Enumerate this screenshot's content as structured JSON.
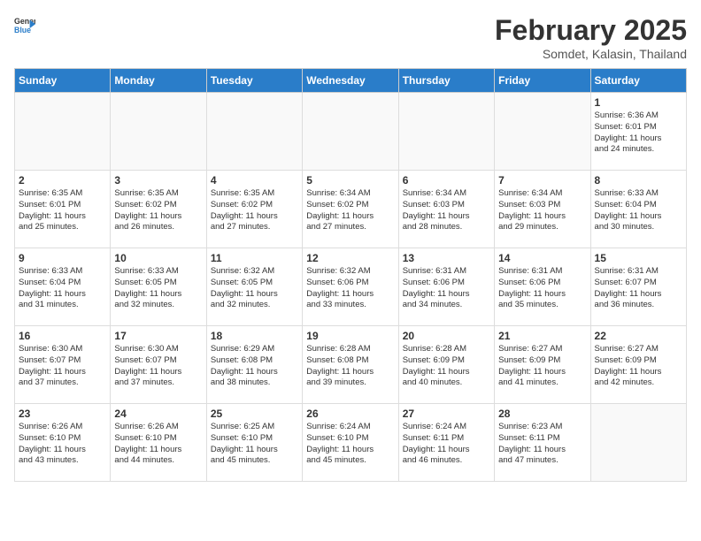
{
  "logo": {
    "general": "General",
    "blue": "Blue"
  },
  "title": "February 2025",
  "subtitle": "Somdet, Kalasin, Thailand",
  "weekdays": [
    "Sunday",
    "Monday",
    "Tuesday",
    "Wednesday",
    "Thursday",
    "Friday",
    "Saturday"
  ],
  "weeks": [
    [
      {
        "day": "",
        "info": ""
      },
      {
        "day": "",
        "info": ""
      },
      {
        "day": "",
        "info": ""
      },
      {
        "day": "",
        "info": ""
      },
      {
        "day": "",
        "info": ""
      },
      {
        "day": "",
        "info": ""
      },
      {
        "day": "1",
        "info": "Sunrise: 6:36 AM\nSunset: 6:01 PM\nDaylight: 11 hours\nand 24 minutes."
      }
    ],
    [
      {
        "day": "2",
        "info": "Sunrise: 6:35 AM\nSunset: 6:01 PM\nDaylight: 11 hours\nand 25 minutes."
      },
      {
        "day": "3",
        "info": "Sunrise: 6:35 AM\nSunset: 6:02 PM\nDaylight: 11 hours\nand 26 minutes."
      },
      {
        "day": "4",
        "info": "Sunrise: 6:35 AM\nSunset: 6:02 PM\nDaylight: 11 hours\nand 27 minutes."
      },
      {
        "day": "5",
        "info": "Sunrise: 6:34 AM\nSunset: 6:02 PM\nDaylight: 11 hours\nand 27 minutes."
      },
      {
        "day": "6",
        "info": "Sunrise: 6:34 AM\nSunset: 6:03 PM\nDaylight: 11 hours\nand 28 minutes."
      },
      {
        "day": "7",
        "info": "Sunrise: 6:34 AM\nSunset: 6:03 PM\nDaylight: 11 hours\nand 29 minutes."
      },
      {
        "day": "8",
        "info": "Sunrise: 6:33 AM\nSunset: 6:04 PM\nDaylight: 11 hours\nand 30 minutes."
      }
    ],
    [
      {
        "day": "9",
        "info": "Sunrise: 6:33 AM\nSunset: 6:04 PM\nDaylight: 11 hours\nand 31 minutes."
      },
      {
        "day": "10",
        "info": "Sunrise: 6:33 AM\nSunset: 6:05 PM\nDaylight: 11 hours\nand 32 minutes."
      },
      {
        "day": "11",
        "info": "Sunrise: 6:32 AM\nSunset: 6:05 PM\nDaylight: 11 hours\nand 32 minutes."
      },
      {
        "day": "12",
        "info": "Sunrise: 6:32 AM\nSunset: 6:06 PM\nDaylight: 11 hours\nand 33 minutes."
      },
      {
        "day": "13",
        "info": "Sunrise: 6:31 AM\nSunset: 6:06 PM\nDaylight: 11 hours\nand 34 minutes."
      },
      {
        "day": "14",
        "info": "Sunrise: 6:31 AM\nSunset: 6:06 PM\nDaylight: 11 hours\nand 35 minutes."
      },
      {
        "day": "15",
        "info": "Sunrise: 6:31 AM\nSunset: 6:07 PM\nDaylight: 11 hours\nand 36 minutes."
      }
    ],
    [
      {
        "day": "16",
        "info": "Sunrise: 6:30 AM\nSunset: 6:07 PM\nDaylight: 11 hours\nand 37 minutes."
      },
      {
        "day": "17",
        "info": "Sunrise: 6:30 AM\nSunset: 6:07 PM\nDaylight: 11 hours\nand 37 minutes."
      },
      {
        "day": "18",
        "info": "Sunrise: 6:29 AM\nSunset: 6:08 PM\nDaylight: 11 hours\nand 38 minutes."
      },
      {
        "day": "19",
        "info": "Sunrise: 6:28 AM\nSunset: 6:08 PM\nDaylight: 11 hours\nand 39 minutes."
      },
      {
        "day": "20",
        "info": "Sunrise: 6:28 AM\nSunset: 6:09 PM\nDaylight: 11 hours\nand 40 minutes."
      },
      {
        "day": "21",
        "info": "Sunrise: 6:27 AM\nSunset: 6:09 PM\nDaylight: 11 hours\nand 41 minutes."
      },
      {
        "day": "22",
        "info": "Sunrise: 6:27 AM\nSunset: 6:09 PM\nDaylight: 11 hours\nand 42 minutes."
      }
    ],
    [
      {
        "day": "23",
        "info": "Sunrise: 6:26 AM\nSunset: 6:10 PM\nDaylight: 11 hours\nand 43 minutes."
      },
      {
        "day": "24",
        "info": "Sunrise: 6:26 AM\nSunset: 6:10 PM\nDaylight: 11 hours\nand 44 minutes."
      },
      {
        "day": "25",
        "info": "Sunrise: 6:25 AM\nSunset: 6:10 PM\nDaylight: 11 hours\nand 45 minutes."
      },
      {
        "day": "26",
        "info": "Sunrise: 6:24 AM\nSunset: 6:10 PM\nDaylight: 11 hours\nand 45 minutes."
      },
      {
        "day": "27",
        "info": "Sunrise: 6:24 AM\nSunset: 6:11 PM\nDaylight: 11 hours\nand 46 minutes."
      },
      {
        "day": "28",
        "info": "Sunrise: 6:23 AM\nSunset: 6:11 PM\nDaylight: 11 hours\nand 47 minutes."
      },
      {
        "day": "",
        "info": ""
      }
    ]
  ]
}
